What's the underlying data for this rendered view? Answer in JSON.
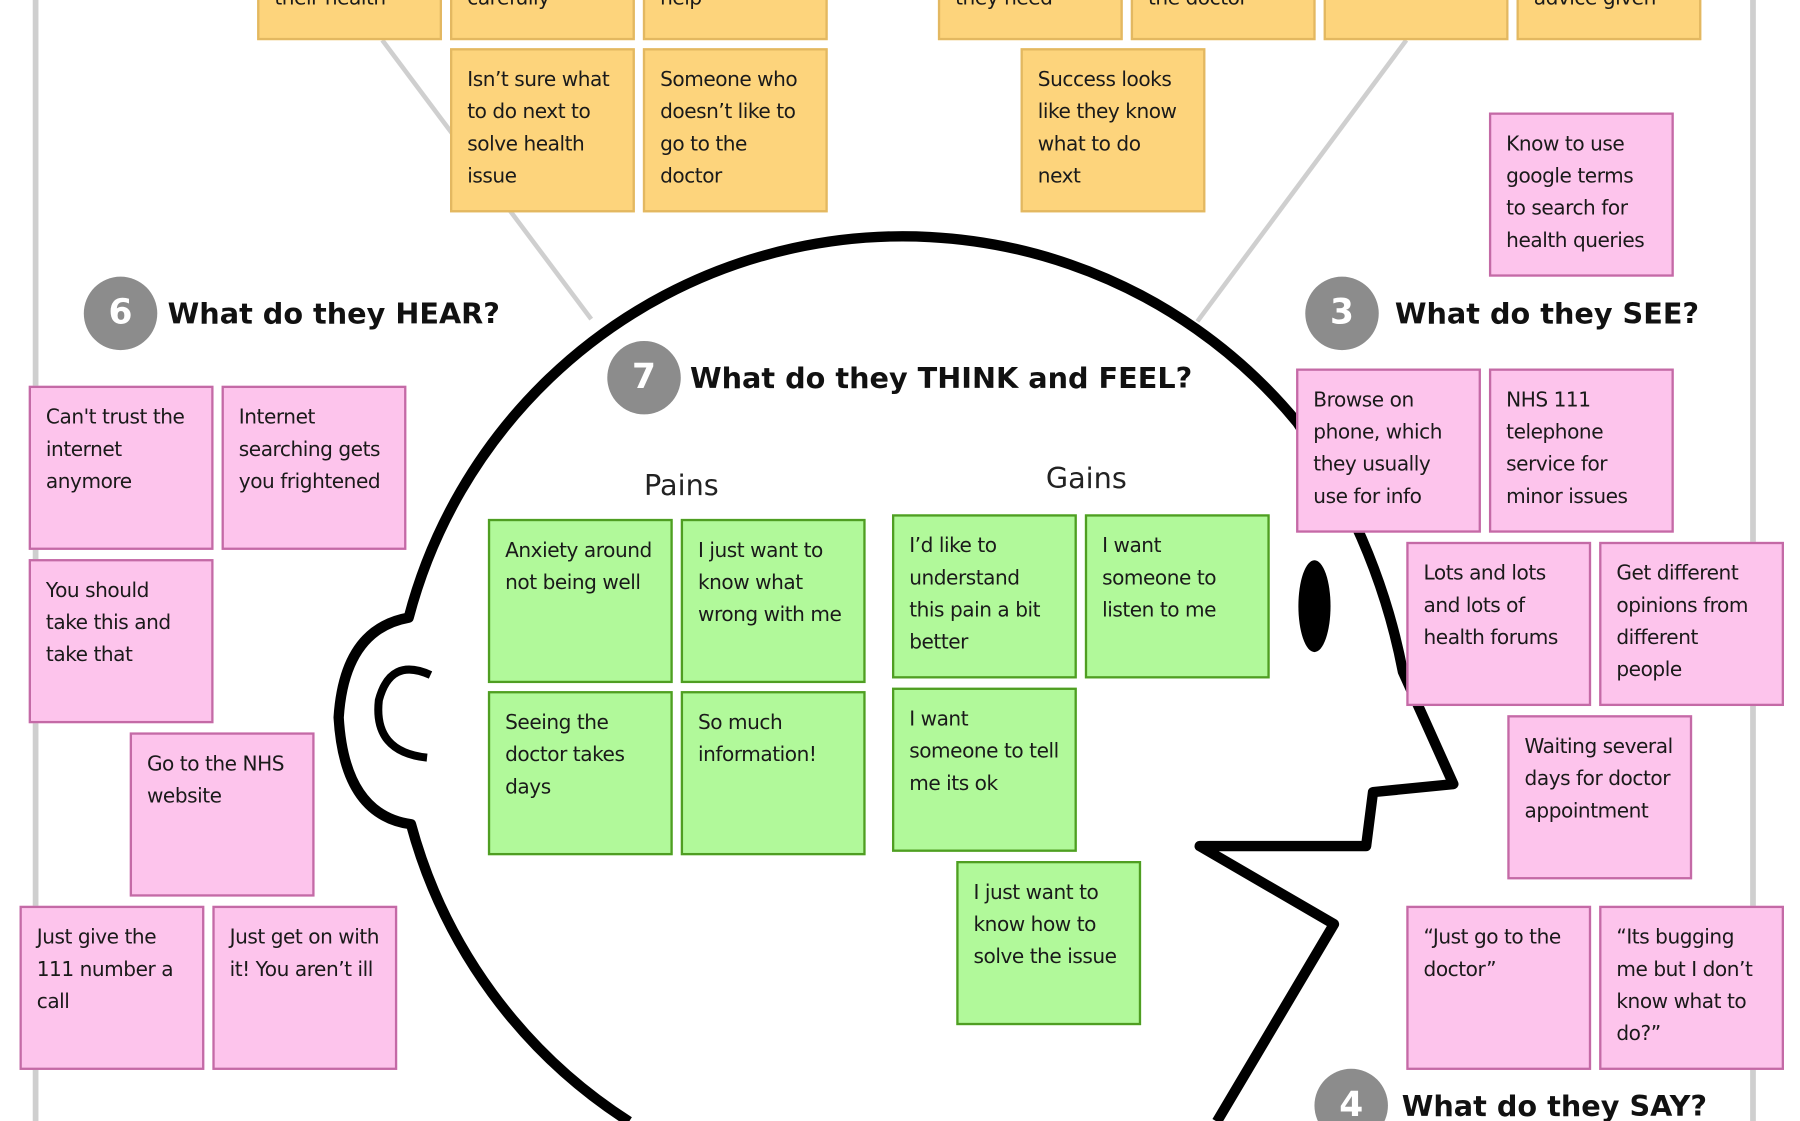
{
  "colors": {
    "yellow_note": "#fdd47c",
    "pink_note": "#fdc4ec",
    "green_note": "#b1f99a",
    "step_badge": "#8c8c8c"
  },
  "sections": {
    "hear": {
      "number": "6",
      "title": "What do they HEAR?"
    },
    "think_feel": {
      "number": "7",
      "title": "What do they THINK and FEEL?",
      "pains_label": "Pains",
      "gains_label": "Gains"
    },
    "see": {
      "number": "3",
      "title": "What do they SEE?"
    },
    "say": {
      "number": "4",
      "title": "What do they SAY?"
    }
  },
  "top_notes": [
    {
      "text": "their health"
    },
    {
      "text": "carefully"
    },
    {
      "text": "help"
    },
    {
      "text": "they need"
    },
    {
      "text": "the doctor"
    },
    {
      "text": ""
    },
    {
      "text": "advice given"
    },
    {
      "text": "Isn’t sure what to do next to solve health issue"
    },
    {
      "text": "Someone who doesn’t like to go to the doctor"
    },
    {
      "text": "Success looks like they know what to do next"
    }
  ],
  "hear_notes": [
    {
      "text": "Can't trust the internet anymore"
    },
    {
      "text": "Internet searching gets you frightened"
    },
    {
      "text": "You should take this and take that"
    },
    {
      "text": "Go to the NHS website"
    },
    {
      "text": "Just give the 111 number a call"
    },
    {
      "text": "Just get on with it! You aren’t ill"
    }
  ],
  "see_notes": [
    {
      "text": "Know to use google terms to search for health queries"
    },
    {
      "text": "Browse on phone, which they usually use for info"
    },
    {
      "text": "NHS 111 telephone service for minor issues"
    },
    {
      "text": "Lots and lots and lots of health forums"
    },
    {
      "text": "Get different opinions from different people"
    },
    {
      "text": "Waiting several days for doctor appointment"
    }
  ],
  "say_notes": [
    {
      "text": "“Just go to the doctor”"
    },
    {
      "text": "“Its bugging me but I don’t know what to do?”"
    }
  ],
  "pains": [
    {
      "text": "Anxiety around not being well"
    },
    {
      "text": "I just want to know what wrong with me"
    },
    {
      "text": "Seeing the doctor takes days"
    },
    {
      "text": "So much information!"
    }
  ],
  "gains": [
    {
      "text": "I’d like to understand this pain a bit better"
    },
    {
      "text": "I want someone to listen to me"
    },
    {
      "text": "I want someone to tell me its ok"
    },
    {
      "text": "I just want to know how to solve the issue"
    }
  ]
}
